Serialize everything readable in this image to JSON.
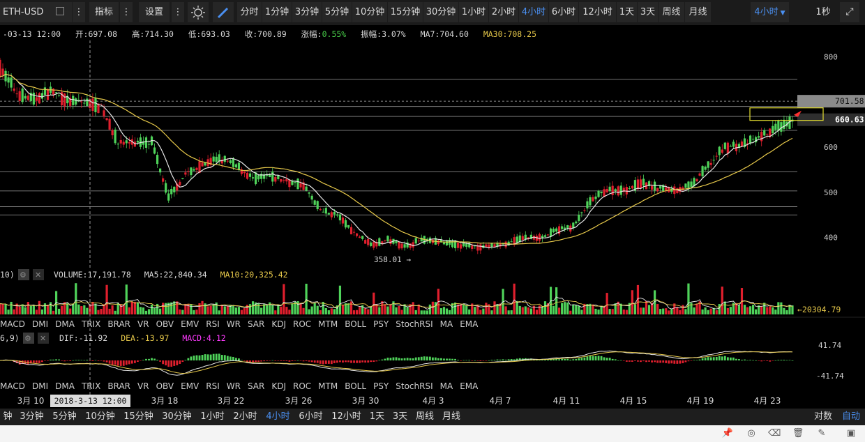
{
  "toolbar": {
    "symbol": "ETH-USD",
    "indicator_label": "指标",
    "settings_label": "设置",
    "intervals": [
      "分时",
      "1分钟",
      "3分钟",
      "5分钟",
      "10分钟",
      "15分钟",
      "30分钟",
      "1小时",
      "2小时",
      "4小时",
      "6小时",
      "12小时",
      "1天",
      "3天",
      "周线",
      "月线"
    ],
    "selected_interval": "4小时",
    "interval_dropdown": "4小时",
    "speed_label": "1秒"
  },
  "info_bar": {
    "date": "2018-03-13 12:00",
    "open": "开:697.08",
    "high": "高:714.30",
    "low": "低:693.03",
    "close": "收:700.89",
    "change_label": "涨幅:",
    "change_value": "0.55%",
    "amplitude": "振幅:3.07%",
    "ma7": "MA7:704.60",
    "ma30": "MA30:708.25"
  },
  "volume_bar": {
    "prefix": "10)",
    "volume": "VOLUME:17,191.78",
    "ma5": "MA5:22,840.34",
    "ma10": "MA10:20,325.42",
    "last_marker": "←20304.79"
  },
  "macd_bar": {
    "prefix": "6,9)",
    "dif": "DIF:-11.92",
    "dea": "DEA:-13.97",
    "macd": "MACD:4.12",
    "upper_label": "41.74",
    "lower_label": "-41.74"
  },
  "indicator_tabs": [
    "MACD",
    "DMI",
    "DMA",
    "TRIX",
    "BRAR",
    "VR",
    "OBV",
    "EMV",
    "RSI",
    "WR",
    "SAR",
    "KDJ",
    "ROC",
    "MTM",
    "BOLL",
    "PSY",
    "StochRSI",
    "MA",
    "EMA"
  ],
  "bottom_intervals": [
    "钟",
    "3分钟",
    "5分钟",
    "10分钟",
    "15分钟",
    "30分钟",
    "1小时",
    "2小时",
    "4小时",
    "6小时",
    "12小时",
    "1天",
    "3天",
    "周线",
    "月线"
  ],
  "bottom_selected": "4小时",
  "bottom_right": {
    "log": "对数",
    "auto": "自动"
  },
  "price_axis": {
    "ticks": [
      800,
      700,
      600,
      500,
      400
    ]
  },
  "x_axis": {
    "ticks": [
      "3月 10",
      "3月 18",
      "3月 22",
      "3月 26",
      "3月 30",
      "4月 3",
      "4月 7",
      "4月 11",
      "4月 15",
      "4月 19",
      "4月 23"
    ],
    "crosshair_label": "2018-3-13 12:00"
  },
  "price_tags": {
    "upper": "701.58",
    "current": "660.63"
  },
  "min_label": "358.01 →",
  "colors": {
    "up": "#4fd35a",
    "down": "#e01f2d",
    "ma7": "#e6e6e6",
    "ma30": "#e6c84a",
    "accent": "#4a8ff0",
    "macd": "#ff3aff",
    "pct": "#49d04a"
  },
  "status_icons": [
    "pin-icon",
    "target-icon",
    "delete-icon",
    "trash-icon",
    "edit-icon",
    "camera-icon"
  ],
  "chart_data": {
    "type": "candlestick",
    "symbol": "ETH-USD",
    "interval": "4小时",
    "x_range": [
      "2018-03-08",
      "2018-04-24"
    ],
    "ylim": [
      330,
      870
    ],
    "yticks": [
      800,
      700,
      600,
      500,
      400
    ],
    "horizontal_levels": [
      750,
      690,
      668,
      637,
      545,
      503,
      468,
      450
    ],
    "anchors": [
      [
        "2018-03-08",
        775
      ],
      [
        "2018-03-09",
        720
      ],
      [
        "2018-03-10",
        705
      ],
      [
        "2018-03-11",
        725
      ],
      [
        "2018-03-12",
        700
      ],
      [
        "2018-03-13",
        700
      ],
      [
        "2018-03-14",
        690
      ],
      [
        "2018-03-15",
        610
      ],
      [
        "2018-03-16",
        610
      ],
      [
        "2018-03-17",
        610
      ],
      [
        "2018-03-18",
        490
      ],
      [
        "2018-03-19",
        540
      ],
      [
        "2018-03-20",
        560
      ],
      [
        "2018-03-21",
        575
      ],
      [
        "2018-03-22",
        560
      ],
      [
        "2018-03-23",
        530
      ],
      [
        "2018-03-24",
        535
      ],
      [
        "2018-03-25",
        525
      ],
      [
        "2018-03-26",
        515
      ],
      [
        "2018-03-27",
        460
      ],
      [
        "2018-03-28",
        450
      ],
      [
        "2018-03-29",
        410
      ],
      [
        "2018-03-30",
        385
      ],
      [
        "2018-03-31",
        395
      ],
      [
        "2018-04-01",
        380
      ],
      [
        "2018-04-02",
        395
      ],
      [
        "2018-04-03",
        390
      ],
      [
        "2018-04-04",
        385
      ],
      [
        "2018-04-05",
        380
      ],
      [
        "2018-04-06",
        380
      ],
      [
        "2018-04-07",
        385
      ],
      [
        "2018-04-08",
        400
      ],
      [
        "2018-04-09",
        400
      ],
      [
        "2018-04-10",
        415
      ],
      [
        "2018-04-11",
        425
      ],
      [
        "2018-04-12",
        480
      ],
      [
        "2018-04-13",
        505
      ],
      [
        "2018-04-14",
        505
      ],
      [
        "2018-04-15",
        520
      ],
      [
        "2018-04-16",
        510
      ],
      [
        "2018-04-17",
        505
      ],
      [
        "2018-04-18",
        515
      ],
      [
        "2018-04-19",
        560
      ],
      [
        "2018-04-20",
        600
      ],
      [
        "2018-04-21",
        605
      ],
      [
        "2018-04-22",
        620
      ],
      [
        "2018-04-23",
        640
      ],
      [
        "2018-04-24",
        655
      ]
    ],
    "last_close": 660.63,
    "min_low": 358.01,
    "volume": {
      "last": 20304.79
    },
    "macd": {
      "range": [
        -41.74,
        41.74
      ]
    }
  }
}
